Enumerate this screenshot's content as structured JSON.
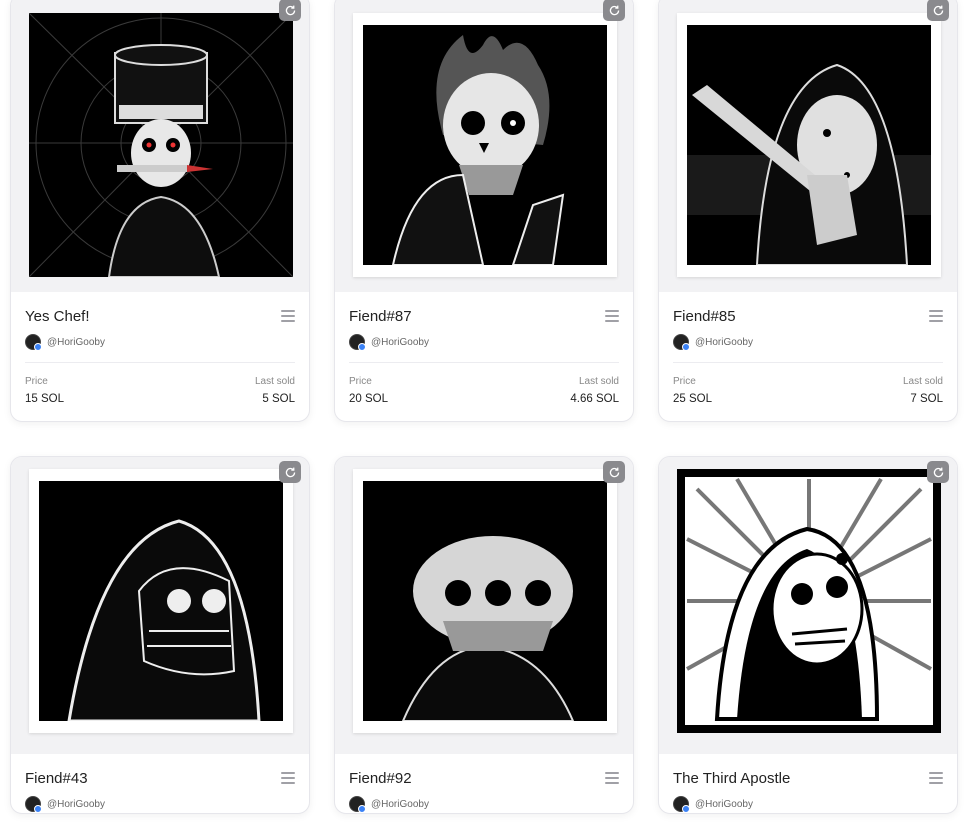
{
  "price_label": "Price",
  "last_sold_label": "Last sold",
  "cards": [
    {
      "title": "Yes Chef!",
      "creator": "@HoriGooby",
      "price": "15 SOL",
      "last_sold": "5 SOL",
      "art": "chef"
    },
    {
      "title": "Fiend#87",
      "creator": "@HoriGooby",
      "price": "20 SOL",
      "last_sold": "4.66 SOL",
      "art": "flame-skull"
    },
    {
      "title": "Fiend#85",
      "creator": "@HoriGooby",
      "price": "25 SOL",
      "last_sold": "7 SOL",
      "art": "machete"
    },
    {
      "title": "Fiend#43",
      "creator": "@HoriGooby",
      "art": "hooded"
    },
    {
      "title": "Fiend#92",
      "creator": "@HoriGooby",
      "art": "triple"
    },
    {
      "title": "The Third Apostle",
      "creator": "@HoriGooby",
      "art": "apostle"
    }
  ],
  "icons": {
    "refresh": "refresh-icon",
    "menu": "menu-icon",
    "avatar": "avatar"
  },
  "colors": {
    "card_border": "#e6e6eb",
    "accent_badge": "#3b82f6"
  }
}
